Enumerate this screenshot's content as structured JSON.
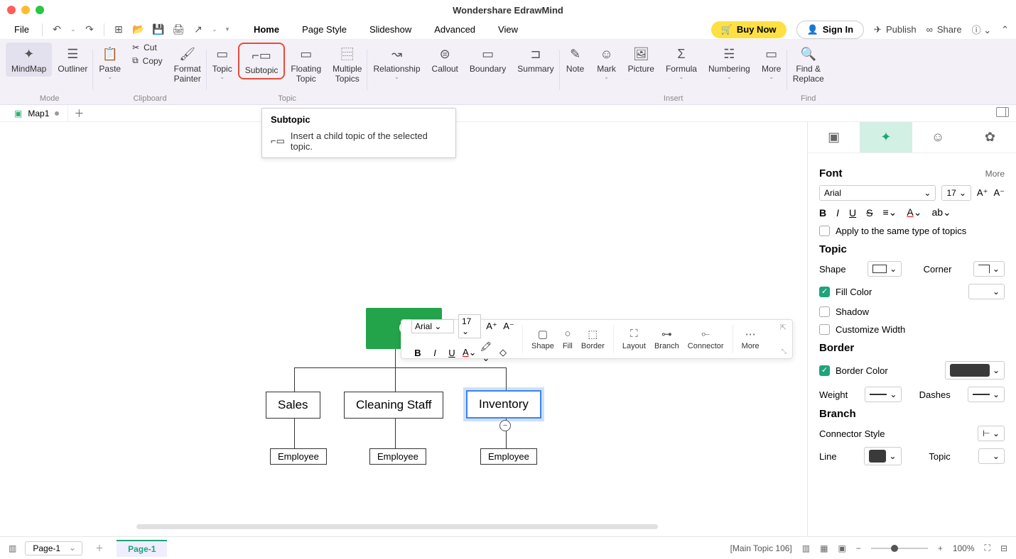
{
  "app_title": "Wondershare EdrawMind",
  "menu": {
    "file": "File",
    "tabs": [
      "Home",
      "Page Style",
      "Slideshow",
      "Advanced",
      "View"
    ],
    "active_tab": "Home",
    "buy_now": "Buy Now",
    "sign_in": "Sign In",
    "publish": "Publish",
    "share": "Share"
  },
  "ribbon": {
    "mindmap": "MindMap",
    "outliner": "Outliner",
    "mode_label": "Mode",
    "paste": "Paste",
    "cut": "Cut",
    "copy": "Copy",
    "format_painter": "Format\nPainter",
    "clipboard_label": "Clipboard",
    "topic": "Topic",
    "subtopic": "Subtopic",
    "floating_topic": "Floating\nTopic",
    "multiple_topics": "Multiple\nTopics",
    "topic_label": "Topic",
    "relationship": "Relationship",
    "callout": "Callout",
    "boundary": "Boundary",
    "summary": "Summary",
    "note": "Note",
    "mark": "Mark",
    "picture": "Picture",
    "formula": "Formula",
    "numbering": "Numbering",
    "more": "More",
    "insert_label": "Insert",
    "find_replace": "Find &\nReplace",
    "find_label": "Find"
  },
  "doc_tab": "Map1",
  "tooltip": {
    "title": "Subtopic",
    "body": "Insert a child topic of the selected topic."
  },
  "canvas": {
    "owner": "Ow",
    "sales": "Sales",
    "cleaning": "Cleaning Staff",
    "inventory": "Inventory",
    "employee": "Employee"
  },
  "float_toolbar": {
    "font": "Arial",
    "size": "17",
    "shape": "Shape",
    "fill": "Fill",
    "border": "Border",
    "layout": "Layout",
    "branch": "Branch",
    "connector": "Connector",
    "more": "More"
  },
  "panel": {
    "font_title": "Font",
    "more": "More",
    "font_name": "Arial",
    "font_size": "17",
    "apply_same": "Apply to the same type of topics",
    "topic_title": "Topic",
    "shape": "Shape",
    "corner": "Corner",
    "fill_color": "Fill Color",
    "shadow": "Shadow",
    "customize_width": "Customize Width",
    "border_title": "Border",
    "border_color": "Border Color",
    "weight": "Weight",
    "dashes": "Dashes",
    "branch_title": "Branch",
    "connector_style": "Connector Style",
    "line": "Line",
    "topic_lbl": "Topic",
    "border_color_hex": "#3a3a3a",
    "line_color_hex": "#3a3a3a"
  },
  "statusbar": {
    "page_sel": "Page-1",
    "page_tab": "Page-1",
    "status_text": "[Main Topic 106]",
    "zoom": "100%"
  }
}
